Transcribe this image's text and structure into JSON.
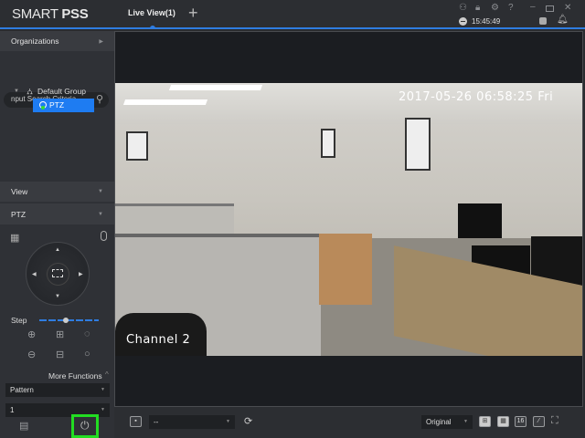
{
  "app": {
    "logo_light": "SMART ",
    "logo_bold": "PSS"
  },
  "tabs": [
    {
      "label": "Live View(1)"
    }
  ],
  "add_tab": "+",
  "header": {
    "time": "15:45:49"
  },
  "sidebar": {
    "organizations": "Organizations",
    "search_placeholder": "nput Search Criteria",
    "tree": {
      "group": "Default Group",
      "device": "PTZ"
    },
    "view": "View",
    "ptz": "PTZ",
    "step_label": "Step",
    "step_value": 0.45,
    "more_functions": "More Functions",
    "pattern_select": "Pattern",
    "number_select": "1"
  },
  "video": {
    "timestamp": "2017-05-26 06:58:25 Fri",
    "channel": "Channel 2"
  },
  "bottombar": {
    "stream_select": "--",
    "scale_select": "Original",
    "layout16": "16"
  },
  "colors": {
    "accent": "#2f7de1",
    "selected": "#1e7cf2",
    "highlight": "#22dd22"
  }
}
